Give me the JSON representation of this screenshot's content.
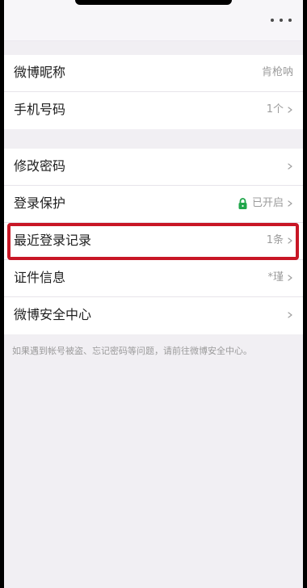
{
  "header": {
    "more_icon": "more-icon"
  },
  "account_info": {
    "nickname": {
      "label": "微博昵称",
      "value": "肯枪呐"
    },
    "phone": {
      "label": "手机号码",
      "value": "1个"
    }
  },
  "security": {
    "change_password": {
      "label": "修改密码"
    },
    "login_protection": {
      "label": "登录保护",
      "value": "已开启",
      "icon": "lock-icon",
      "status_color": "#1fa64a"
    },
    "recent_logins": {
      "label": "最近登录记录",
      "value": "1条"
    },
    "id_info": {
      "label": "证件信息",
      "value": "*瑾"
    },
    "security_center": {
      "label": "微博安全中心"
    }
  },
  "footer": {
    "tip": "如果遇到帐号被盗、忘记密码等问题，请前往微博安全中心。"
  },
  "colors": {
    "highlight": "#c81625",
    "background": "#f1eff3",
    "card": "#ffffff"
  }
}
